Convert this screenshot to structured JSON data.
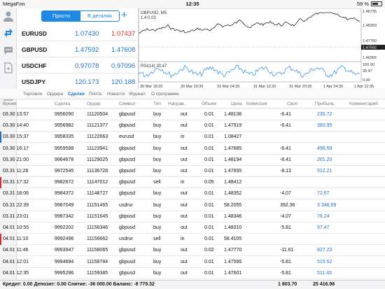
{
  "status": {
    "carrier": "MegaFon",
    "time": "12:35",
    "battery": "59 %"
  },
  "quotes": {
    "tab_simple": "Просто",
    "tab_details": "В деталях",
    "rows": [
      {
        "symbol": "EURUSD",
        "bid": "1.07430",
        "ask": "1.07437",
        "ask_color": "#d32f2f"
      },
      {
        "symbol": "GBPUSD",
        "bid": "1.47592",
        "ask": "1.47608",
        "ask_color": "#1e73c8"
      },
      {
        "symbol": "USDCHF",
        "bid": "0.97078",
        "ask": "0.97096",
        "ask_color": "#1e73c8"
      },
      {
        "symbol": "USDJPY",
        "bid": "120.173",
        "ask": "120.188",
        "ask_color": "#1e73c8"
      }
    ]
  },
  "chart": {
    "title": "GBPUSD, M5",
    "subtitle": "1.4 0.03",
    "indicator": "RSI(14) 30.47",
    "price_labels": [
      "1.48735",
      "1.48350",
      "1.47760",
      "1.47592",
      "1.46965"
    ],
    "rsi_labels": [
      "100.00",
      "30.47",
      "0.00"
    ],
    "time_labels": [
      "30 Mar 18:20",
      "30 Mar 20:35",
      "31 Mar 04:35",
      "31 Mar 12:35",
      "31 Mar 20:35",
      "1 Apr 04:35",
      "1 Apr 12:35"
    ]
  },
  "tabs": [
    "Торговля",
    "Ордера",
    "Сделки",
    "Почта",
    "Новости",
    "Журнал",
    "О программе"
  ],
  "active_tab": "Сделки",
  "columns": [
    "Время",
    "Сделка",
    "Ордер",
    "Символ",
    "Тип",
    "Направ...",
    "Объем",
    "Цена",
    "Комиссия",
    "Своп",
    "Прибыль",
    "Комментарий"
  ],
  "rows": [
    {
      "time": "03.30 13:57",
      "deal": "9956090",
      "order": "11120504",
      "symbol": "gbpusd",
      "type": "buy",
      "dir": "out",
      "vol": "0.01",
      "price": "1.48136",
      "comm": "",
      "swap": "-6.41",
      "profit": "235.72",
      "mark": ""
    },
    {
      "time": "03.30 14:40",
      "deal": "9956982",
      "order": "11121377",
      "symbol": "gbpusd",
      "type": "buy",
      "dir": "out",
      "vol": "0.01",
      "price": "1.47919",
      "comm": "",
      "swap": "-6.41",
      "profit": "360.95",
      "mark": ""
    },
    {
      "time": "03.30 15:37",
      "deal": "9958335",
      "order": "11122663",
      "symbol": "eurusd",
      "type": "buy",
      "dir": "in",
      "vol": "0.01",
      "price": "1.08427",
      "comm": "",
      "swap": "",
      "profit": "",
      "mark": "#1e73c8"
    },
    {
      "time": "03.30 16:17",
      "deal": "9959598",
      "order": "11123941",
      "symbol": "gbpusd",
      "type": "buy",
      "dir": "out",
      "vol": "0.01",
      "price": "1.47685",
      "comm": "",
      "swap": "-6.41",
      "profit": "496.59",
      "mark": ""
    },
    {
      "time": "03.30 21:00",
      "deal": "9964678",
      "order": "11129025",
      "symbol": "gbpusd",
      "type": "buy",
      "dir": "out",
      "vol": "0.01",
      "price": "1.48194",
      "comm": "",
      "swap": "-6.41",
      "profit": "201.20",
      "mark": ""
    },
    {
      "time": "03.31 11:28",
      "deal": "9972545",
      "order": "11136728",
      "symbol": "gbpusd",
      "type": "buy",
      "dir": "out",
      "vol": "0.01",
      "price": "1.47655",
      "comm": "",
      "swap": "-8.13",
      "profit": "512.21",
      "mark": ""
    },
    {
      "time": "03.31 17:32",
      "deal": "9982672",
      "order": "11147012",
      "symbol": "gbpusd",
      "type": "sell",
      "dir": "in",
      "vol": "0.05",
      "price": "1.48412",
      "comm": "",
      "swap": "",
      "profit": "",
      "mark": "#d32f2f"
    },
    {
      "time": "03.31 18:06",
      "deal": "9984372",
      "order": "11148727",
      "symbol": "gbpusd",
      "type": "buy",
      "dir": "out",
      "vol": "0.01",
      "price": "1.48352",
      "comm": "",
      "swap": "-4.07",
      "profit": "72.67",
      "mark": ""
    },
    {
      "time": "03.31 22:39",
      "deal": "9987049",
      "order": "11151465",
      "symbol": "usdrur",
      "type": "buy",
      "dir": "out",
      "vol": "0.01",
      "price": "58.2055",
      "comm": "",
      "swap": "392.36",
      "profit": "3 346.59",
      "mark": ""
    },
    {
      "time": "03.31 23:01",
      "deal": "9987342",
      "order": "11151645",
      "symbol": "gbpusd",
      "type": "buy",
      "dir": "out",
      "vol": "0.01",
      "price": "1.48346",
      "comm": "",
      "swap": "-4.07",
      "profit": "76.24",
      "mark": ""
    },
    {
      "time": "04.01 10:55",
      "deal": "9992202",
      "order": "11156346",
      "symbol": "gbpusd",
      "type": "buy",
      "dir": "out",
      "vol": "0.01",
      "price": "1.48310",
      "comm": "",
      "swap": "-5.81",
      "profit": "97.47",
      "mark": ""
    },
    {
      "time": "04.01 11:10",
      "deal": "9992496",
      "order": "11156662",
      "symbol": "usdrur",
      "type": "sell",
      "dir": "in",
      "vol": "0.01",
      "price": "58.4105",
      "comm": "",
      "swap": "",
      "profit": "",
      "mark": "#d32f2f"
    },
    {
      "time": "04.01 11:46",
      "deal": "9993947",
      "order": "11158065",
      "symbol": "gbpusd",
      "type": "buy",
      "dir": "out",
      "vol": "0.02",
      "price": "1.47770",
      "comm": "",
      "swap": "-11.61",
      "profit": "827.23",
      "mark": ""
    },
    {
      "time": "04.01 12:01",
      "deal": "9994694",
      "order": "11158784",
      "symbol": "gbpusd",
      "type": "buy",
      "dir": "out",
      "vol": "0.01",
      "price": "1.47595",
      "comm": "",
      "swap": "-5.81",
      "profit": "515.52",
      "mark": ""
    },
    {
      "time": "04.01 12:35",
      "deal": "9995286",
      "order": "11159385",
      "symbol": "gbpusd",
      "type": "buy",
      "dir": "out",
      "vol": "0.01",
      "price": "1.47601",
      "comm": "",
      "swap": "-5.81",
      "profit": "511.33",
      "mark": ""
    }
  ],
  "footer": {
    "summary": "Кредит: 0.00 Депозит: 0.00 Снятие: -36 000.00 Баланс: -8 779.32",
    "swap_total": "1 803.70",
    "profit_total": "25 416.98"
  }
}
